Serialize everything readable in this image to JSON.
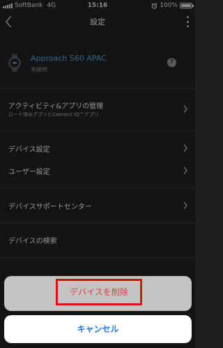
{
  "status_bar": {
    "carrier": "SoftBank",
    "network": "4G",
    "time": "15:16",
    "battery_percent": "100%",
    "battery_level": 1.0
  },
  "nav": {
    "title": "設定"
  },
  "device": {
    "name": "Approach S60 APAC",
    "status": "未接続",
    "help_icon": "?"
  },
  "menu": {
    "activities": {
      "label": "アクティビティ&アプリの管理",
      "sublabel": "ロード済みアプリとConnect IQ™アプリ"
    },
    "device_settings": "デバイス設定",
    "user_settings": "ユーザー設定",
    "support_center": "デバイスサポートセンター",
    "device_search": "デバイスの検索"
  },
  "action_sheet": {
    "delete_label": "デバイスを削除",
    "cancel_label": "キャンセル"
  },
  "colors": {
    "background": "#1f1f1f",
    "accent_blue": "#4a9ed6",
    "cancel_blue": "#1a7cf0",
    "destructive_red": "#e23c3c",
    "highlight_border": "#e01010"
  },
  "icons": {
    "back": "chevron-left-icon",
    "more": "more-vertical-icon",
    "device": "watch-icon",
    "help": "help-icon",
    "chevron": "chevron-right-icon",
    "alarm": "alarm-clock-icon",
    "battery": "battery-icon"
  }
}
